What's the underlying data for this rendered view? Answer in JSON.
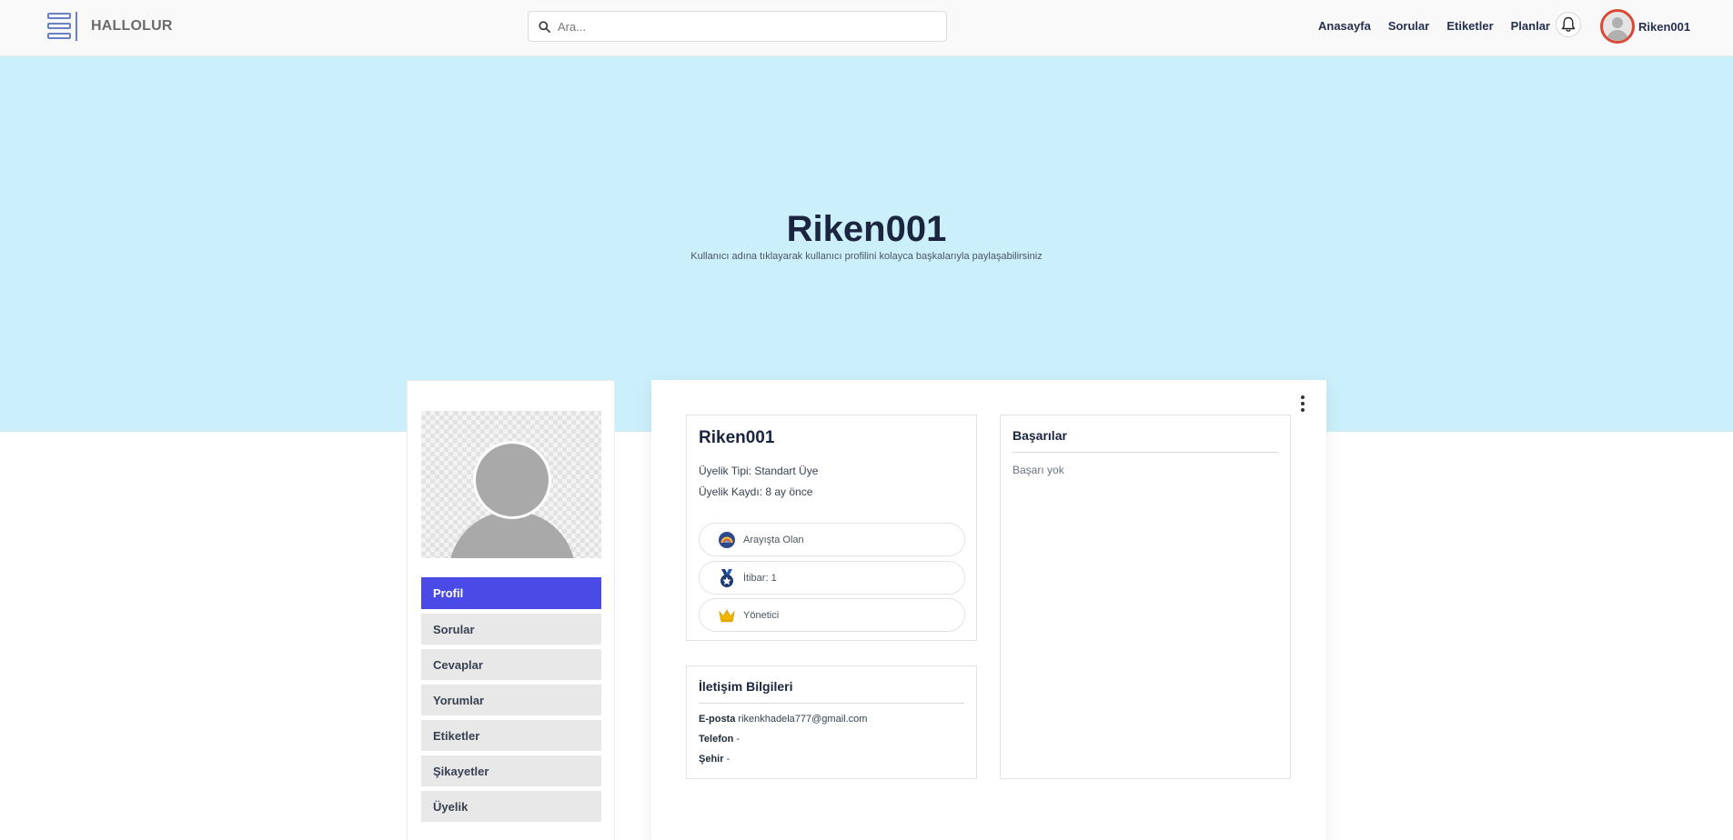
{
  "header": {
    "brand": "HALLOLUR",
    "search_placeholder": "Ara...",
    "nav": [
      "Anasayfa",
      "Sorular",
      "Etiketler",
      "Planlar"
    ],
    "username": "Riken001"
  },
  "hero": {
    "title": "Riken001",
    "subtitle": "Kullanıcı adına tıklayarak kullanıcı profilini kolayca başkalarıyla paylaşabilirsiniz"
  },
  "sidebar": {
    "items": [
      {
        "label": "Profil",
        "active": true
      },
      {
        "label": "Sorular"
      },
      {
        "label": "Cevaplar"
      },
      {
        "label": "Yorumlar"
      },
      {
        "label": "Etiketler"
      },
      {
        "label": "Şikayetler"
      },
      {
        "label": "Üyelik"
      }
    ]
  },
  "profile": {
    "name": "Riken001",
    "membership_type": "Üyelik Tipi: Standart Üye",
    "registered": "Üyelik Kaydı: 8 ay önce",
    "badges": [
      {
        "label": "Arayışta Olan",
        "icon": "seeker-badge-icon"
      },
      {
        "label": "İtibar: 1",
        "icon": "medal-icon"
      },
      {
        "label": "Yönetici",
        "icon": "crown-icon"
      }
    ]
  },
  "contact": {
    "title": "İletişim Bilgileri",
    "email_label": "E-posta",
    "email": "rikenkhadela777@gmail.com",
    "phone_label": "Telefon",
    "phone": "-",
    "city_label": "Şehir",
    "city": "-"
  },
  "achievements": {
    "title": "Başarılar",
    "empty": "Başarı yok"
  },
  "colors": {
    "hero_bg": "#ccf0fb",
    "accent": "#4a4ae6",
    "avatar_ring": "#d94a36",
    "crown": "#f2b600",
    "medal": "#1f3b73"
  }
}
